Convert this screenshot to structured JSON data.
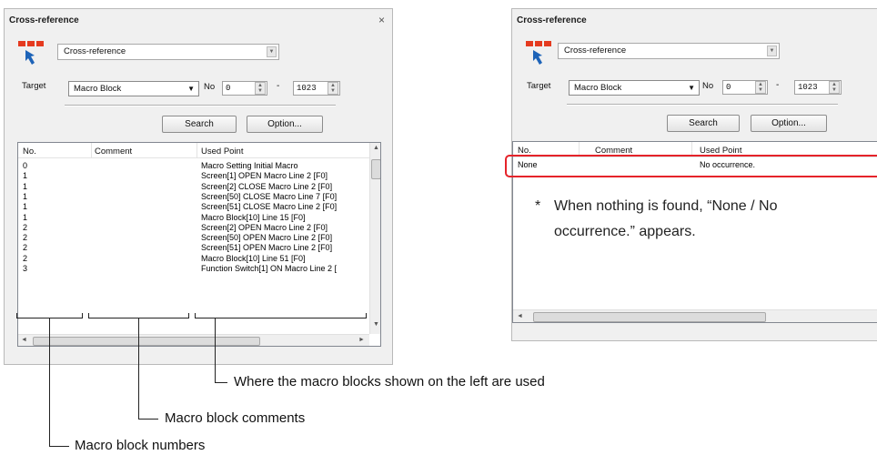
{
  "left_panel": {
    "title": "Cross-reference",
    "close_glyph": "×",
    "mode_combo": "Cross-reference",
    "target_label": "Target",
    "target_value": "Macro Block",
    "no_label": "No",
    "range_from": "0",
    "range_dash": "-",
    "range_to": "1023",
    "search_button": "Search",
    "option_button": "Option...",
    "columns": [
      "No.",
      "Comment",
      "Used Point"
    ],
    "rows": [
      {
        "no": "0",
        "comment": "",
        "used": "Macro Setting Initial Macro"
      },
      {
        "no": "1",
        "comment": "",
        "used": "Screen[1] OPEN Macro Line 2 [F0]"
      },
      {
        "no": "1",
        "comment": "",
        "used": "Screen[2] CLOSE Macro Line 2 [F0]"
      },
      {
        "no": "1",
        "comment": "",
        "used": "Screen[50] CLOSE Macro Line 7 [F0]"
      },
      {
        "no": "1",
        "comment": "",
        "used": "Screen[51] CLOSE Macro Line 2 [F0]"
      },
      {
        "no": "1",
        "comment": "",
        "used": "Macro Block[10] Line 15 [F0]"
      },
      {
        "no": "2",
        "comment": "",
        "used": "Screen[2] OPEN Macro Line 2 [F0]"
      },
      {
        "no": "2",
        "comment": "",
        "used": "Screen[50] OPEN Macro Line 2 [F0]"
      },
      {
        "no": "2",
        "comment": "",
        "used": "Screen[51] OPEN Macro Line 2 [F0]"
      },
      {
        "no": "2",
        "comment": "",
        "used": "Macro Block[10] Line 51 [F0]"
      },
      {
        "no": "3",
        "comment": "",
        "used": "Function Switch[1] ON Macro Line 2 ["
      }
    ]
  },
  "right_panel": {
    "title": "Cross-reference",
    "mode_combo": "Cross-reference",
    "target_label": "Target",
    "target_value": "Macro Block",
    "no_label": "No",
    "range_from": "0",
    "range_dash": "-",
    "range_to": "1023",
    "search_button": "Search",
    "option_button": "Option...",
    "columns": [
      "No.",
      "Comment",
      "Used Point"
    ],
    "row": {
      "no": "None",
      "comment": "",
      "used": "No occurrence."
    },
    "note_bullet": "*",
    "note_line1": "When nothing is found, “None / No",
    "note_line2": "occurrence.” appears."
  },
  "callouts": {
    "used_point": "Where the macro blocks shown on the left are used",
    "comments": "Macro block comments",
    "numbers": "Macro block numbers"
  },
  "colors": {
    "highlight": "#e5232a",
    "icon_red": "#e53a1f",
    "icon_arrow": "#1d63b8"
  },
  "icons": [
    "close-icon",
    "cross-reference-icon",
    "dropdown-arrow-icon",
    "spin-arrows-icon"
  ]
}
